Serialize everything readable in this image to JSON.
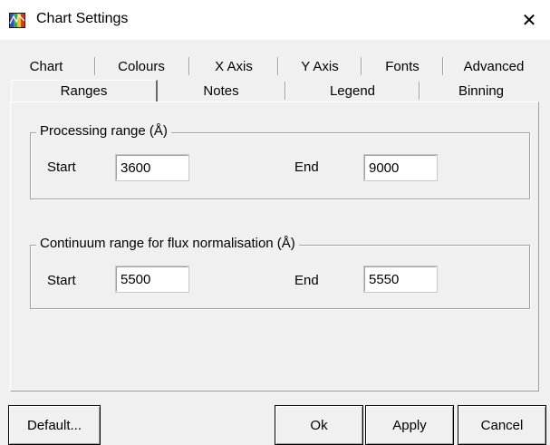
{
  "window": {
    "title": "Chart Settings",
    "close_glyph": "✕",
    "icon": "app-icon"
  },
  "tabs": {
    "row1": [
      {
        "label": "Chart"
      },
      {
        "label": "Colours"
      },
      {
        "label": "X Axis"
      },
      {
        "label": "Y Axis"
      },
      {
        "label": "Fonts"
      },
      {
        "label": "Advanced"
      }
    ],
    "row2": [
      {
        "label": "Ranges",
        "active": true
      },
      {
        "label": "Notes"
      },
      {
        "label": "Legend"
      },
      {
        "label": "Binning"
      }
    ]
  },
  "processing": {
    "legend": "Processing range (Å)",
    "start_label": "Start",
    "start_value": "3600",
    "end_label": "End",
    "end_value": "9000"
  },
  "continuum": {
    "legend": "Continuum range for flux normalisation (Å)",
    "start_label": "Start",
    "start_value": "5500",
    "end_label": "End",
    "end_value": "5550"
  },
  "buttons": {
    "default": "Default...",
    "ok": "Ok",
    "apply": "Apply",
    "cancel": "Cancel"
  }
}
